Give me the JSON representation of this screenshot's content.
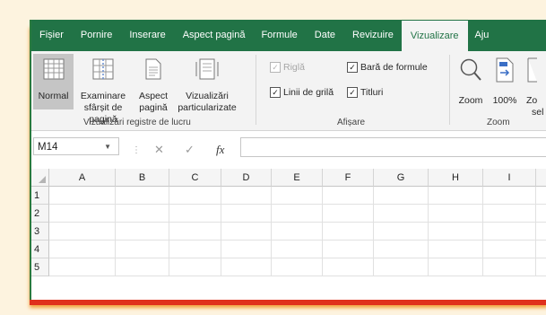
{
  "tabs": [
    "Fișier",
    "Pornire",
    "Inserare",
    "Aspect pagină",
    "Formule",
    "Date",
    "Revizuire",
    "Vizualizare",
    "Aju"
  ],
  "active_tab": "Vizualizare",
  "ribbon": {
    "workbook_views": {
      "group_label": "Vizualizări registre de lucru",
      "normal": "Normal",
      "page_break_1": "Examinare",
      "page_break_2": "sfârșit de pagină",
      "page_layout_1": "Aspect",
      "page_layout_2": "pagină",
      "custom_1": "Vizualizări",
      "custom_2": "particularizate"
    },
    "show": {
      "group_label": "Afișare",
      "ruler": "Riglă",
      "formula_bar": "Bară de formule",
      "gridlines": "Linii de grilă",
      "headings": "Titluri",
      "ruler_checked": true,
      "formula_bar_checked": true,
      "gridlines_checked": true,
      "headings_checked": true
    },
    "zoom": {
      "group_label": "Zoom",
      "zoom": "Zoom",
      "zoom100": "100%",
      "zoom_sel_1": "Zo",
      "zoom_sel_2": "sel"
    }
  },
  "formula_bar": {
    "name_box": "M14",
    "cancel": "✕",
    "enter": "✓",
    "fx": "fx",
    "content": ""
  },
  "sheet": {
    "columns": [
      "A",
      "B",
      "C",
      "D",
      "E",
      "F",
      "G",
      "H",
      "I"
    ],
    "rows": [
      "1",
      "2",
      "3",
      "4",
      "5"
    ]
  },
  "colors": {
    "accent": "#217346",
    "ribbon_bg": "#f3f3f3",
    "frame_shadow": "#e0301c"
  }
}
